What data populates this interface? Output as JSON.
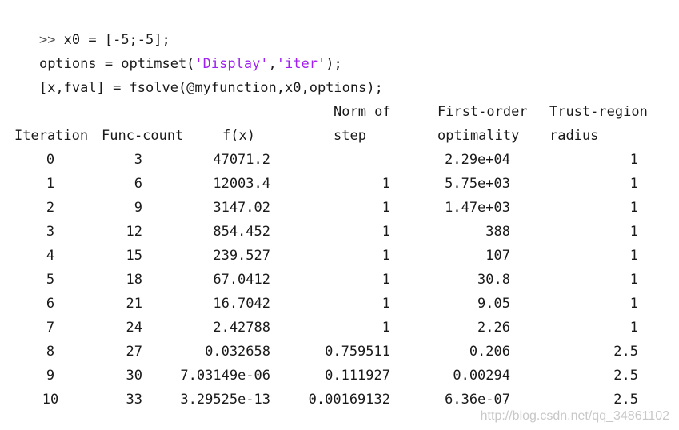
{
  "commands": [
    {
      "prompt": ">>",
      "code": " x0 = [-5;-5];"
    },
    {
      "prefix": "options = optimset(",
      "s1": "'Display'",
      "mid": ",",
      "s2": "'iter'",
      "suffix": ");"
    },
    {
      "code": "[x,fval] = fsolve(@myfunction,x0,options);"
    }
  ],
  "table": {
    "headers_top": {
      "norm": "Norm of",
      "firstorder": "First-order",
      "trust": "Trust-region"
    },
    "headers_bottom": {
      "iteration": "Iteration",
      "funccount": "Func-count",
      "fx": "f(x)",
      "step": "step",
      "optimality": "optimality",
      "radius": "radius"
    },
    "rows": [
      {
        "iteration": "0",
        "funccount": "3",
        "fx": "47071.2",
        "step": "",
        "optimality": "2.29e+04",
        "radius": "1"
      },
      {
        "iteration": "1",
        "funccount": "6",
        "fx": "12003.4",
        "step": "1",
        "optimality": "5.75e+03",
        "radius": "1"
      },
      {
        "iteration": "2",
        "funccount": "9",
        "fx": "3147.02",
        "step": "1",
        "optimality": "1.47e+03",
        "radius": "1"
      },
      {
        "iteration": "3",
        "funccount": "12",
        "fx": "854.452",
        "step": "1",
        "optimality": "388",
        "radius": "1"
      },
      {
        "iteration": "4",
        "funccount": "15",
        "fx": "239.527",
        "step": "1",
        "optimality": "107",
        "radius": "1"
      },
      {
        "iteration": "5",
        "funccount": "18",
        "fx": "67.0412",
        "step": "1",
        "optimality": "30.8",
        "radius": "1"
      },
      {
        "iteration": "6",
        "funccount": "21",
        "fx": "16.7042",
        "step": "1",
        "optimality": "9.05",
        "radius": "1"
      },
      {
        "iteration": "7",
        "funccount": "24",
        "fx": "2.42788",
        "step": "1",
        "optimality": "2.26",
        "radius": "1"
      },
      {
        "iteration": "8",
        "funccount": "27",
        "fx": "0.032658",
        "step": "0.759511",
        "optimality": "0.206",
        "radius": "2.5"
      },
      {
        "iteration": "9",
        "funccount": "30",
        "fx": "7.03149e-06",
        "step": "0.111927",
        "optimality": "0.00294",
        "radius": "2.5"
      },
      {
        "iteration": "10",
        "funccount": "33",
        "fx": "3.29525e-13",
        "step": "0.00169132",
        "optimality": "6.36e-07",
        "radius": "2.5"
      }
    ]
  },
  "watermark": "http://blog.csdn.net/qq_34861102"
}
